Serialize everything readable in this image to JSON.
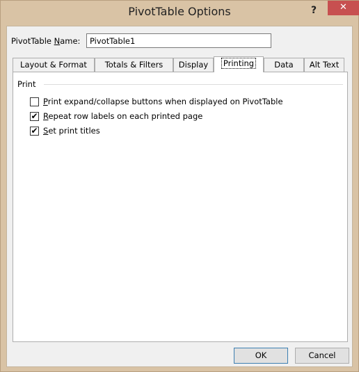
{
  "window": {
    "title": "PivotTable Options",
    "help_label": "?",
    "close_label": "✕"
  },
  "name_row": {
    "label_pre": "PivotTable ",
    "label_ul": "N",
    "label_post": "ame:",
    "value": "PivotTable1"
  },
  "tabs": [
    {
      "label": "Layout & Format"
    },
    {
      "label": "Totals & Filters"
    },
    {
      "label": "Display"
    },
    {
      "label": "Printing",
      "active": true
    },
    {
      "label": "Data"
    },
    {
      "label": "Alt Text"
    }
  ],
  "print_group": {
    "label": "Print",
    "options": [
      {
        "pre": "",
        "ul": "P",
        "post": "rint expand/collapse buttons when displayed on PivotTable",
        "checked": false
      },
      {
        "pre": "",
        "ul": "R",
        "post": "epeat row labels on each printed page",
        "checked": true
      },
      {
        "pre": "",
        "ul": "S",
        "post": "et print titles",
        "checked": true
      }
    ]
  },
  "buttons": {
    "ok": "OK",
    "cancel": "Cancel"
  },
  "colors": {
    "frame": "#d9c3a5",
    "close": "#c75050",
    "client": "#f0f0f0"
  }
}
